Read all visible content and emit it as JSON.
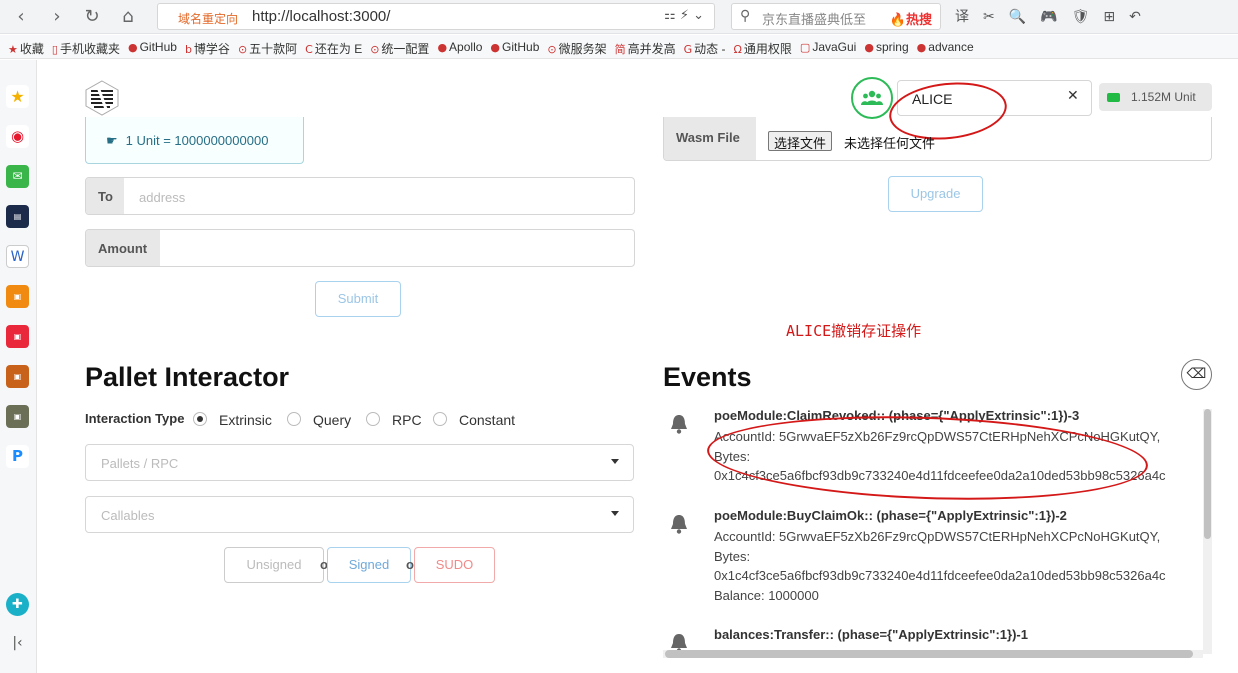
{
  "browser": {
    "redirect_label": "域名重定向",
    "url": "http://localhost:3000/",
    "url_icons": "⚏  ⚡  ⌄",
    "search_text": "京东直播盛典低至",
    "search_hot": "🔥热搜",
    "toolbar_icons": "译✂🔍🎮🛡⊞↶"
  },
  "bookmarks": [
    {
      "icon": "★",
      "label": "收藏"
    },
    {
      "icon": "▯",
      "label": "手机收藏夹"
    },
    {
      "icon": "●",
      "label": "GitHub"
    },
    {
      "icon": "b",
      "label": "博学谷"
    },
    {
      "icon": "⊙",
      "label": "五十款阿"
    },
    {
      "icon": "C",
      "label": "还在为 E"
    },
    {
      "icon": "⊙",
      "label": "统一配置"
    },
    {
      "icon": "●",
      "label": "Apollo"
    },
    {
      "icon": "●",
      "label": "GitHub"
    },
    {
      "icon": "⊙",
      "label": "微服务架"
    },
    {
      "icon": "简",
      "label": "高并发高"
    },
    {
      "icon": "G",
      "label": "动态 -"
    },
    {
      "icon": "Ω",
      "label": "通用权限"
    },
    {
      "icon": "▢",
      "label": "JavaGui"
    },
    {
      "icon": "●",
      "label": "spring"
    },
    {
      "icon": "●",
      "label": "advance"
    }
  ],
  "header": {
    "account": "ALICE",
    "balance": "1.152M Unit"
  },
  "transfer": {
    "unit_info": "1 Unit = 1000000000000",
    "to_label": "To",
    "to_placeholder": "address",
    "amount_label": "Amount",
    "submit_label": "Submit"
  },
  "upgrade": {
    "wasm_label": "Wasm File",
    "choose_file": "选择文件",
    "no_file": "未选择任何文件",
    "upgrade_label": "Upgrade"
  },
  "annotation": "ALICE撤销存证操作",
  "pallet": {
    "title": "Pallet Interactor",
    "interaction_label": "Interaction Type",
    "options": [
      "Extrinsic",
      "Query",
      "RPC",
      "Constant"
    ],
    "pallets_placeholder": "Pallets / RPC",
    "callables_placeholder": "Callables",
    "unsigned_label": "Unsigned",
    "or_label": "or",
    "signed_label": "Signed",
    "sudo_label": "SUDO"
  },
  "events": {
    "title": "Events",
    "items": [
      {
        "title": "poeModule:ClaimRevoked:: (phase={\"ApplyExtrinsic\":1})-3",
        "lines": [
          "AccountId: 5GrwvaEF5zXb26Fz9rcQpDWS57CtERHpNehXCPcNoHGKutQY,",
          "Bytes:",
          "0x1c4cf3ce5a6fbcf93db9c733240e4d11fdceefee0da2a10ded53bb98c5326a4c"
        ]
      },
      {
        "title": "poeModule:BuyClaimOk:: (phase={\"ApplyExtrinsic\":1})-2",
        "lines": [
          "AccountId: 5GrwvaEF5zXb26Fz9rcQpDWS57CtERHpNehXCPcNoHGKutQY,",
          "Bytes:",
          "0x1c4cf3ce5a6fbcf93db9c733240e4d11fdceefee0da2a10ded53bb98c5326a4c",
          "Balance: 1000000"
        ]
      },
      {
        "title": "balances:Transfer:: (phase={\"ApplyExtrinsic\":1})-1",
        "lines": []
      }
    ]
  },
  "colors": {
    "annotation_red": "#d41818",
    "account_green": "#2dbb58",
    "info_blue": "#276f86"
  }
}
